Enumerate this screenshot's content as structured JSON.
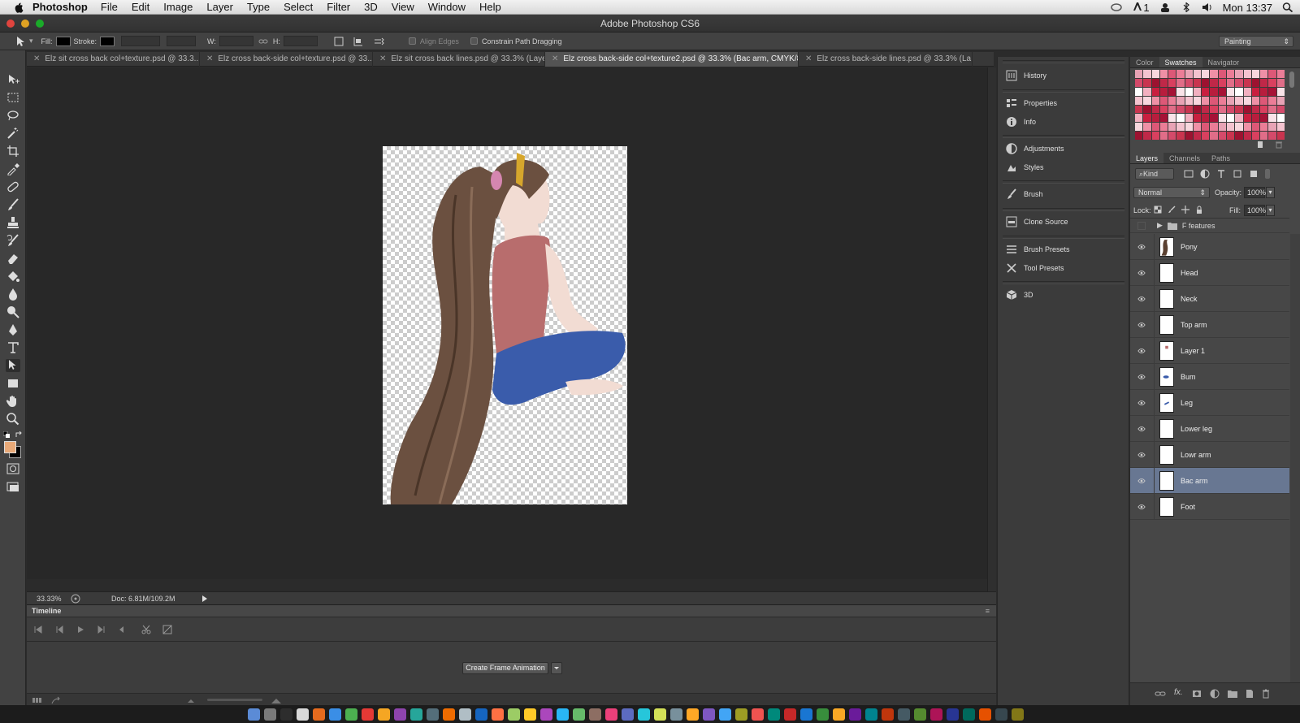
{
  "menubar": {
    "app_name": "Photoshop",
    "items": [
      "File",
      "Edit",
      "Image",
      "Layer",
      "Type",
      "Select",
      "Filter",
      "3D",
      "View",
      "Window",
      "Help"
    ],
    "status_text": "1",
    "clock": "Mon 13:37"
  },
  "window": {
    "title": "Adobe Photoshop CS6"
  },
  "options": {
    "fill_label": "Fill:",
    "stroke_label": "Stroke:",
    "w_label": "W:",
    "h_label": "H:",
    "align_edges": "Align Edges",
    "constrain": "Constrain Path Dragging",
    "workspace": "Painting"
  },
  "tabs": [
    {
      "label": "Elz sit cross back col+texture.psd @ 33.3...",
      "active": false
    },
    {
      "label": "Elz cross back-side col+texture.psd @ 33...",
      "active": false
    },
    {
      "label": "Elz sit cross back lines.psd @ 33.3% (Laye...",
      "active": false
    },
    {
      "label": "Elz cross back-side col+texture2.psd @ 33.3% (Bac arm, CMYK/8#)",
      "active": true
    },
    {
      "label": "Elz cross back-side lines.psd @ 33.3% (La...",
      "active": false
    }
  ],
  "status": {
    "zoom": "33.33%",
    "doc": "Doc: 6.81M/109.2M"
  },
  "timeline": {
    "title": "Timeline",
    "create_button": "Create Frame Animation"
  },
  "dock_panels": [
    {
      "label": "History",
      "icon": "history-icon"
    },
    {
      "label": "Properties",
      "icon": "properties-icon"
    },
    {
      "label": "Info",
      "icon": "info-icon"
    },
    {
      "label": "Adjustments",
      "icon": "adjustments-icon"
    },
    {
      "label": "Styles",
      "icon": "styles-icon"
    },
    {
      "label": "Brush",
      "icon": "brush-icon"
    },
    {
      "label": "Clone Source",
      "icon": "clone-source-icon"
    },
    {
      "label": "Brush Presets",
      "icon": "brush-presets-icon"
    },
    {
      "label": "Tool Presets",
      "icon": "tool-presets-icon"
    },
    {
      "label": "3D",
      "icon": "cube-icon"
    }
  ],
  "color_panel": {
    "tabs": [
      "Color",
      "Swatches",
      "Navigator"
    ],
    "active": "Swatches"
  },
  "layers_panel": {
    "tabs": [
      "Layers",
      "Channels",
      "Paths"
    ],
    "active": "Layers",
    "filter_kind": "Kind",
    "blend_mode": "Normal",
    "opacity_label": "Opacity:",
    "opacity": "100%",
    "lock_label": "Lock:",
    "fill_label": "Fill:",
    "fill": "100%",
    "group": "F features",
    "layers": [
      {
        "name": "Pony",
        "selected": false
      },
      {
        "name": "Head",
        "selected": false
      },
      {
        "name": "Neck",
        "selected": false
      },
      {
        "name": "Top arm",
        "selected": false
      },
      {
        "name": "Layer 1",
        "selected": false
      },
      {
        "name": "Bum",
        "selected": false
      },
      {
        "name": "Leg",
        "selected": false
      },
      {
        "name": "Lower leg",
        "selected": false
      },
      {
        "name": "Lowr arm",
        "selected": false
      },
      {
        "name": "Bac arm",
        "selected": true
      },
      {
        "name": "Foot",
        "selected": false
      }
    ]
  },
  "colors": {
    "foreground": "#e8a978",
    "background": "#000000",
    "selection": "#687792"
  }
}
